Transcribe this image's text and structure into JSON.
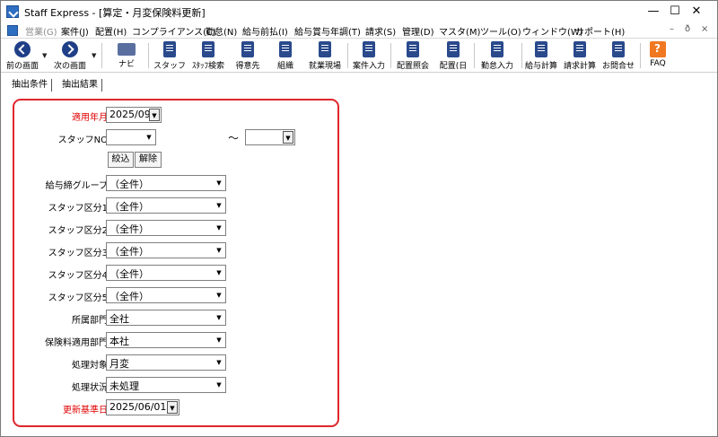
{
  "window": {
    "title": "Staff Express - [算定・月変保険料更新]",
    "controls": {
      "minimize": "—",
      "maximize": "☐",
      "close": "✕"
    }
  },
  "menu": {
    "items": [
      {
        "label": "営業(G)",
        "disabled": true
      },
      {
        "label": "案件(J)"
      },
      {
        "label": "配置(H)"
      },
      {
        "label": "コンプライアンス(C)"
      },
      {
        "label": "勤怠(N)"
      },
      {
        "label": "給与前払(I)"
      },
      {
        "label": "給与賞与年調(T)"
      },
      {
        "label": "請求(S)"
      },
      {
        "label": "管理(D)"
      },
      {
        "label": "マスタ(M)"
      },
      {
        "label": "ツール(O)"
      },
      {
        "label": "ウィンドウ(W)"
      },
      {
        "label": "サポート(H)"
      }
    ],
    "mdi_controls": {
      "minimize": "–",
      "restore": "ð",
      "close": "×"
    }
  },
  "toolbar": {
    "buttons": [
      {
        "label": "前の画面",
        "icon": "back-arrow-icon"
      },
      {
        "label": "次の画面",
        "icon": "forward-arrow-icon"
      },
      {
        "label": "ナビ",
        "icon": "keyboard-icon"
      },
      {
        "label": "スタッフ",
        "icon": "staff-icon"
      },
      {
        "label": "ｽﾀｯﾌ検索",
        "icon": "staff-search-icon"
      },
      {
        "label": "得意先",
        "icon": "customer-icon"
      },
      {
        "label": "組織",
        "icon": "organization-icon"
      },
      {
        "label": "就業現場",
        "icon": "worksite-icon"
      },
      {
        "label": "案件入力",
        "icon": "job-entry-icon"
      },
      {
        "label": "配置照会",
        "icon": "placement-inquiry-icon"
      },
      {
        "label": "配置(日",
        "icon": "placement-daily-icon"
      },
      {
        "label": "勤怠入力",
        "icon": "attendance-entry-icon"
      },
      {
        "label": "給与計算",
        "icon": "payroll-calc-icon"
      },
      {
        "label": "請求計算",
        "icon": "billing-calc-icon"
      },
      {
        "label": "お問合せ",
        "icon": "inquiry-icon"
      },
      {
        "label": "FAQ",
        "icon": "faq-icon"
      }
    ]
  },
  "tabs": [
    {
      "label": "抽出条件"
    },
    {
      "label": "抽出結果"
    }
  ],
  "form": {
    "apply_month": {
      "label": "適用年月",
      "value": "2025/09"
    },
    "staff_no": {
      "label": "スタッフNO",
      "from": "",
      "to": "",
      "range_sep": "～"
    },
    "filter_button": "絞込",
    "clear_button": "解除",
    "pay_group": {
      "label": "給与締グループ",
      "value": "（全件）"
    },
    "staff_cat1": {
      "label": "スタッフ区分1",
      "value": "（全件）"
    },
    "staff_cat2": {
      "label": "スタッフ区分2",
      "value": "（全件）"
    },
    "staff_cat3": {
      "label": "スタッフ区分3",
      "value": "（全件）"
    },
    "staff_cat4": {
      "label": "スタッフ区分4",
      "value": "（全件）"
    },
    "staff_cat5": {
      "label": "スタッフ区分5",
      "value": "（全件）"
    },
    "dept": {
      "label": "所属部門",
      "value": "全社"
    },
    "insurance_dept": {
      "label": "保険料適用部門",
      "value": "本社"
    },
    "target": {
      "label": "処理対象",
      "value": "月変"
    },
    "status": {
      "label": "処理状況",
      "value": "未処理"
    },
    "update_date": {
      "label": "更新基準日",
      "value": "2025/06/01"
    }
  },
  "colors": {
    "highlight_border": "#e0262b",
    "required_label": "#e00000"
  }
}
